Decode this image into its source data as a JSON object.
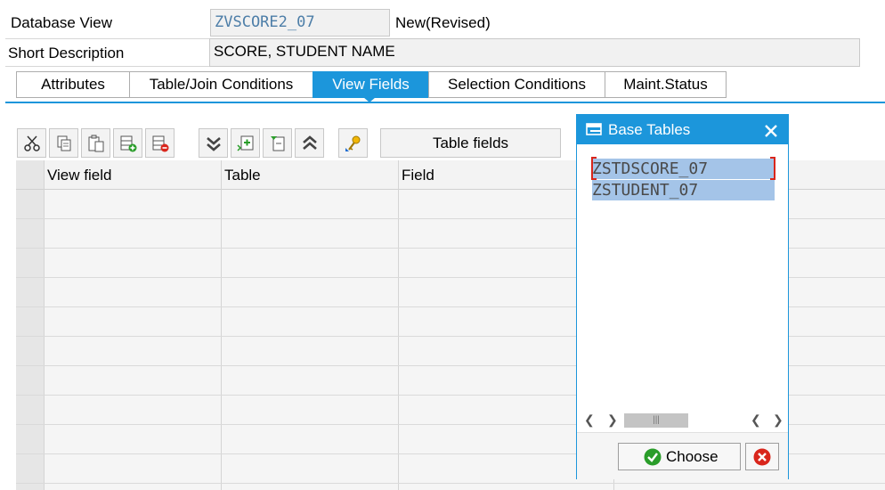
{
  "header": {
    "db_view_label": "Database View",
    "db_view_value": "ZVSCORE2_07",
    "db_view_status": "New(Revised)",
    "short_desc_label": "Short Description",
    "short_desc_value": "SCORE, STUDENT NAME"
  },
  "tabs": [
    {
      "label": "Attributes"
    },
    {
      "label": "Table/Join Conditions"
    },
    {
      "label": "View Fields"
    },
    {
      "label": "Selection Conditions"
    },
    {
      "label": "Maint.Status"
    }
  ],
  "toolbar": {
    "table_fields_label": "Table fields",
    "icons": [
      "cut-icon",
      "copy-icon",
      "paste-icon",
      "insert-row-icon",
      "delete-row-icon",
      "expand-all-icon",
      "insert-field-icon",
      "select-field-icon",
      "collapse-all-icon",
      "key-icon"
    ]
  },
  "grid": {
    "columns": [
      "View field",
      "Table",
      "Field"
    ]
  },
  "dialog": {
    "title": "Base Tables",
    "items": [
      "ZSTDSCORE_07",
      "ZSTUDENT_07"
    ],
    "choose_label": "Choose"
  },
  "colors": {
    "accent": "#1c96db",
    "selection": "#a4c4e8",
    "mono_text": "#4d7ea8"
  }
}
